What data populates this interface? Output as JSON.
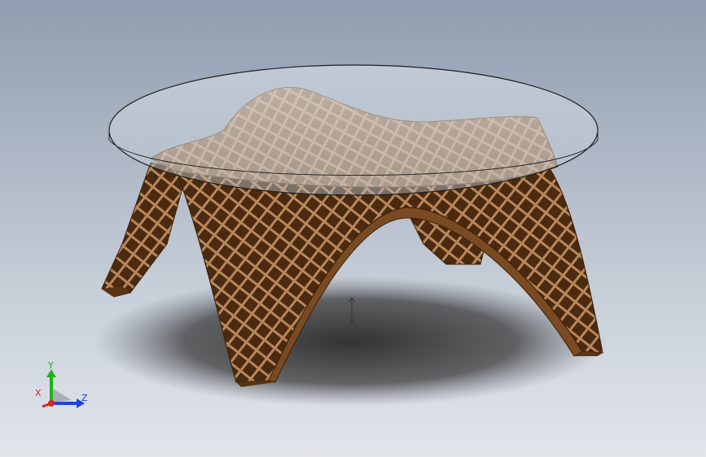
{
  "viewport": {
    "background_top": "#8f9db0",
    "background_bottom": "#e2e5ea"
  },
  "model": {
    "glass_color": "#c8d2dc",
    "wood_color": "#b48a62",
    "wood_dark": "#5a3314",
    "wood_mid": "#7a4a22"
  },
  "triad": {
    "x_label": "X",
    "y_label": "Y",
    "z_label": "Z",
    "x_color": "#e02020",
    "y_color": "#20b020",
    "z_color": "#2040e0"
  }
}
